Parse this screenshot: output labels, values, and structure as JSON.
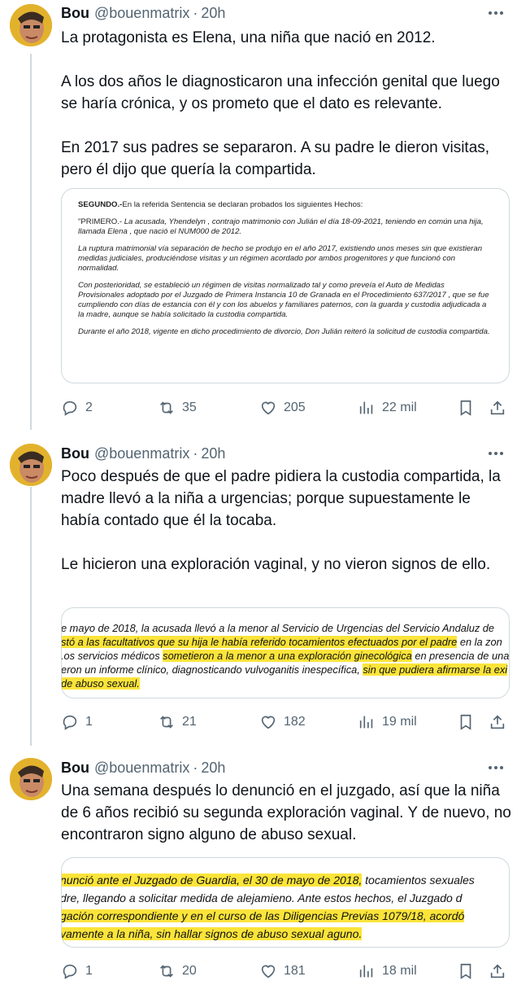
{
  "tweets": [
    {
      "name": "Bou",
      "handle": "@bouenmatrix",
      "time": "20h",
      "paragraphs": [
        "La protagonista es Elena, una niña que nació en 2012.",
        "A los dos años le diagnosticaron una infección genital que luego se haría crónica, y os prometo que el dato es relevante.",
        "En 2017 sus padres se separaron. A su padre le dieron visitas, pero él dijo que quería la compartida."
      ],
      "media": {
        "p1_bold": "SEGUNDO.-",
        "p1_rest": "En la referida Sentencia se declaran probados los siguientes Hechos:",
        "p2_a": "\"PRIMERO.- ",
        "p2_b": "La acusada,  Yhendelyn , contrajo matrimonio con  Julián  el día 18-09-2021, teniendo en común una hija, llamada  Elena , que nació el  NUM000  de 2012.",
        "p3": "La ruptura matrimonial vía separación de hecho se produjo en el año 2017, existiendo unos meses sin que existieran medidas judiciales, produciéndose visitas y un régimen acordado por ambos progenitores y que funcionó con normalidad.",
        "p4": "Con posterioridad, se estableció un régimen de visitas normalizado tal y como preveía el Auto de Medidas Provisionales adoptado por el Juzgado de Primera Instancia 10 de Granada en el Procedimiento 637/2017 , que se fue cumpliendo con días de estancia con él y con los abuelos y familiares paternos, con la guarda y custodia adjudicada a la madre, aunque se había solicitado la custodia compartida.",
        "p5": "Durante el año 2018, vigente en dicho procedimiento de divorcio, Don  Julián  reiteró la solicitud de custodia compartida."
      },
      "stats": {
        "replies": "2",
        "retweets": "35",
        "likes": "205",
        "views": "22 mil"
      }
    },
    {
      "name": "Bou",
      "handle": "@bouenmatrix",
      "time": "20h",
      "paragraphs": [
        "Poco después de que el padre pidiera la custodia compartida, la madre llevó a la niña a urgencias; porque supuestamente le había contado que él la tocaba.",
        "Le hicieron una exploración vaginal, y no vieron signos de ello."
      ],
      "media": {
        "l1": "e mayo de 2018, la acusada llevó a la menor al Servicio de Urgencias del Servicio Andaluz de",
        "l2_hl": "stó a las facultativos que su hija le había referido tocamientos efectuados por el padre",
        "l2_rest": " en la zon",
        "l3_a": ".os servicios médicos ",
        "l3_hl": "sometieron a la menor a una exploración ginecológica",
        "l3_rest": " en presencia de una f",
        "l4_a": "eron un informe clínico, diagnosticando vulvoganitis inespecífica, ",
        "l4_hl": "sin que pudiera afirmarse la exi",
        "l5_hl": "de abuso sexual."
      },
      "stats": {
        "replies": "1",
        "retweets": "21",
        "likes": "182",
        "views": "19 mil"
      }
    },
    {
      "name": "Bou",
      "handle": "@bouenmatrix",
      "time": "20h",
      "paragraphs": [
        "Una semana después lo denunció en el juzgado, así que la niña de 6 años recibió su segunda exploración vaginal. Y de nuevo, no encontraron signo alguno de abuso sexual."
      ],
      "media": {
        "l1_hl": "nunció ante el Juzgado de Guardia, el 30 de mayo de 2018,",
        "l1_rest": " tocamientos sexuales",
        "l2": "dre, llegando a solicitar medida de alejamieno. Ante estos hechos, el Juzgado d",
        "l3_hl": "gación correspondiente y en el curso de las Diligencias Previas 1079/18, acordó",
        "l4_hl": "vamente a la niña, sin hallar signos de abuso sexual aguno."
      },
      "stats": {
        "replies": "1",
        "retweets": "20",
        "likes": "181",
        "views": "18 mil"
      }
    }
  ],
  "icons": [
    "avatar",
    "more-icon",
    "reply-icon",
    "retweet-icon",
    "like-icon",
    "views-icon",
    "bookmark-icon",
    "share-icon"
  ]
}
